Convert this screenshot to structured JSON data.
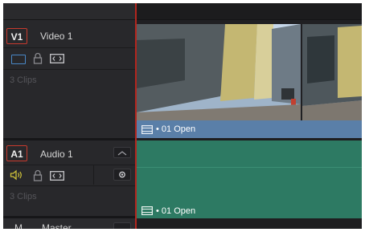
{
  "tracks": {
    "video": {
      "badge": "V1",
      "name": "Video 1",
      "clips_count": "3 Clips",
      "clip_label": "• 01 Open"
    },
    "audio": {
      "badge": "A1",
      "name": "Audio 1",
      "clips_count": "3 Clips",
      "clip_label": "• 01 Open"
    },
    "master": {
      "badge": "M",
      "name": "Master"
    }
  },
  "colors": {
    "track_badge_outline": "#c73a2e",
    "playhead": "#b3261e",
    "video_clip_bar": "#5a7fa8",
    "audio_clip": "#2d7a63",
    "icon_blue": "#4a88c7",
    "icon_yellow": "#cfc23a"
  },
  "icons": [
    "monitor-icon",
    "lock-icon",
    "auto-select-icon",
    "speaker-icon",
    "film-icon",
    "flag-icon",
    "record-icon"
  ]
}
